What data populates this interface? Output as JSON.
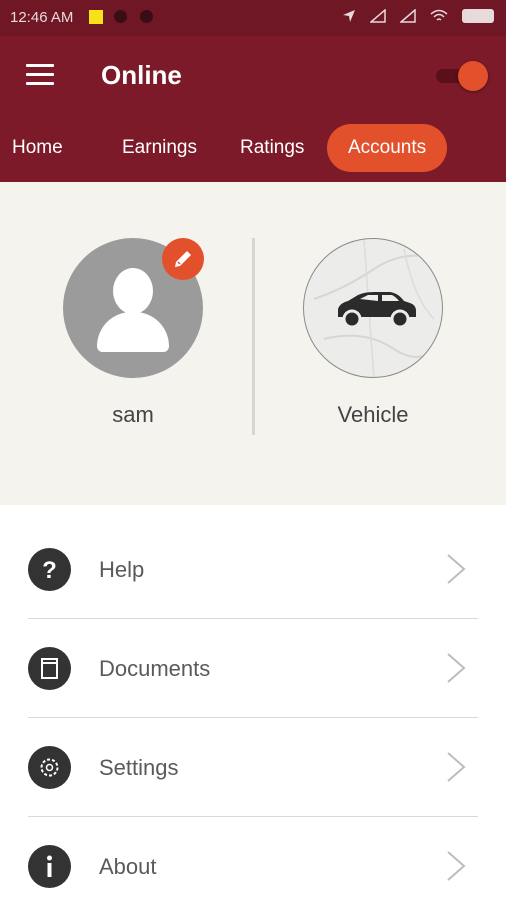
{
  "status_bar": {
    "time": "12:46 AM"
  },
  "app_bar": {
    "title": "Online"
  },
  "tabs": [
    {
      "label": "Home"
    },
    {
      "label": "Earnings"
    },
    {
      "label": "Ratings"
    },
    {
      "label": "Accounts"
    }
  ],
  "profile": {
    "name": "sam",
    "vehicle_label": "Vehicle"
  },
  "menu": [
    {
      "label": "Help",
      "icon": "help-icon"
    },
    {
      "label": "Documents",
      "icon": "documents-icon"
    },
    {
      "label": "Settings",
      "icon": "settings-icon"
    },
    {
      "label": "About",
      "icon": "info-icon"
    }
  ],
  "colors": {
    "primary": "#7c1a29",
    "accent": "#e2512b",
    "background": "#f5f3ee"
  }
}
